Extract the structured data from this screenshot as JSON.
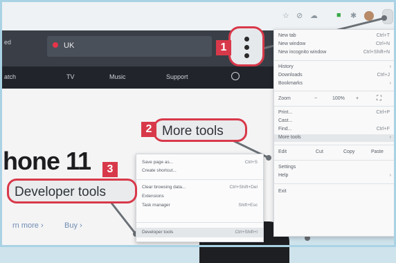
{
  "site": {
    "region_label": "UK",
    "nav": [
      "atch",
      "TV",
      "Music",
      "Support"
    ],
    "headline": "hone 11",
    "subline": "",
    "learn_more": "rn more ›",
    "buy": "Buy ›"
  },
  "main_menu": {
    "items": [
      {
        "label": "New tab",
        "shortcut": "Ctrl+T"
      },
      {
        "label": "New window",
        "shortcut": "Ctrl+N"
      },
      {
        "label": "New incognito window",
        "shortcut": "Ctrl+Shift+N"
      },
      {
        "label": "History",
        "shortcut": ""
      },
      {
        "label": "Downloads",
        "shortcut": "Ctrl+J"
      },
      {
        "label": "Bookmarks",
        "shortcut": ""
      },
      {
        "label": "Zoom",
        "shortcut": ""
      },
      {
        "label": "Print...",
        "shortcut": "Ctrl+P"
      },
      {
        "label": "Cast...",
        "shortcut": ""
      },
      {
        "label": "Find...",
        "shortcut": "Ctrl+F"
      },
      {
        "label": "More tools",
        "shortcut": ""
      },
      {
        "label": "Edit",
        "shortcut": ""
      },
      {
        "label": "Settings",
        "shortcut": ""
      },
      {
        "label": "Help",
        "shortcut": ""
      },
      {
        "label": "Exit",
        "shortcut": ""
      }
    ],
    "zoom_minus": "−",
    "zoom_value": "100%",
    "zoom_plus": "+",
    "edit_cut": "Cut",
    "edit_copy": "Copy",
    "edit_paste": "Paste"
  },
  "submenu": {
    "items": [
      {
        "label": "Save page as...",
        "shortcut": "Ctrl+S"
      },
      {
        "label": "Create shortcut...",
        "shortcut": ""
      },
      {
        "label": "Clear browsing data...",
        "shortcut": "Ctrl+Shift+Del"
      },
      {
        "label": "Extensions",
        "shortcut": ""
      },
      {
        "label": "Task manager",
        "shortcut": "Shift+Esc"
      },
      {
        "label": "Developer tools",
        "shortcut": "Ctrl+Shift+I"
      }
    ]
  },
  "callouts": {
    "step1": "1",
    "step2": "2",
    "step2_text": "More tools",
    "step3": "3",
    "step3_text": "Developer tools"
  },
  "colors": {
    "accent_red": "#d8394a",
    "frame_blue": "#a9d3e4",
    "site_header": "#3a3f47"
  },
  "icons": [
    "star-icon",
    "extension-icon",
    "cloud-icon",
    "shield-icon",
    "puzzle-icon",
    "avatar",
    "kebab-menu-icon",
    "location-pin-icon",
    "search-icon"
  ]
}
